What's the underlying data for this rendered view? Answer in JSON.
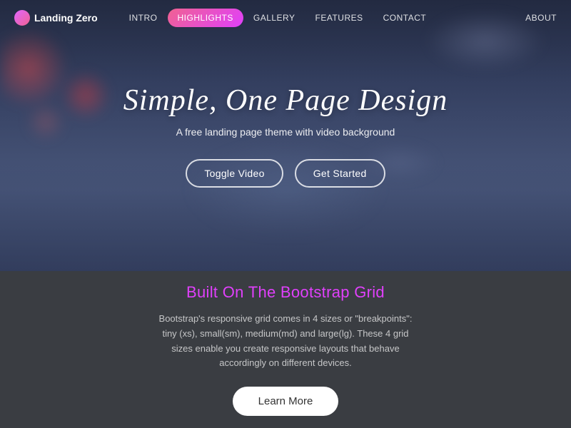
{
  "navbar": {
    "brand": {
      "label": "Landing Zero",
      "icon_name": "brand-circle-icon"
    },
    "links": [
      {
        "label": "INTRO",
        "active": false
      },
      {
        "label": "HIGHLIGHTS",
        "active": true
      },
      {
        "label": "GALLERY",
        "active": false
      },
      {
        "label": "FEATURES",
        "active": false
      },
      {
        "label": "CONTACT",
        "active": false
      }
    ],
    "right_link": {
      "label": "ABOUT"
    }
  },
  "hero": {
    "title": "Simple, One Page Design",
    "subtitle": "A free landing page theme with video background",
    "buttons": {
      "toggle_video": "Toggle Video",
      "get_started": "Get Started"
    }
  },
  "bottom": {
    "title": "Built On The Bootstrap Grid",
    "description": "Bootstrap's responsive grid comes in 4 sizes or \"breakpoints\": tiny (xs), small(sm), medium(md) and large(lg). These 4 grid sizes enable you create responsive layouts that behave accordingly on different devices.",
    "learn_more": "Learn More"
  }
}
